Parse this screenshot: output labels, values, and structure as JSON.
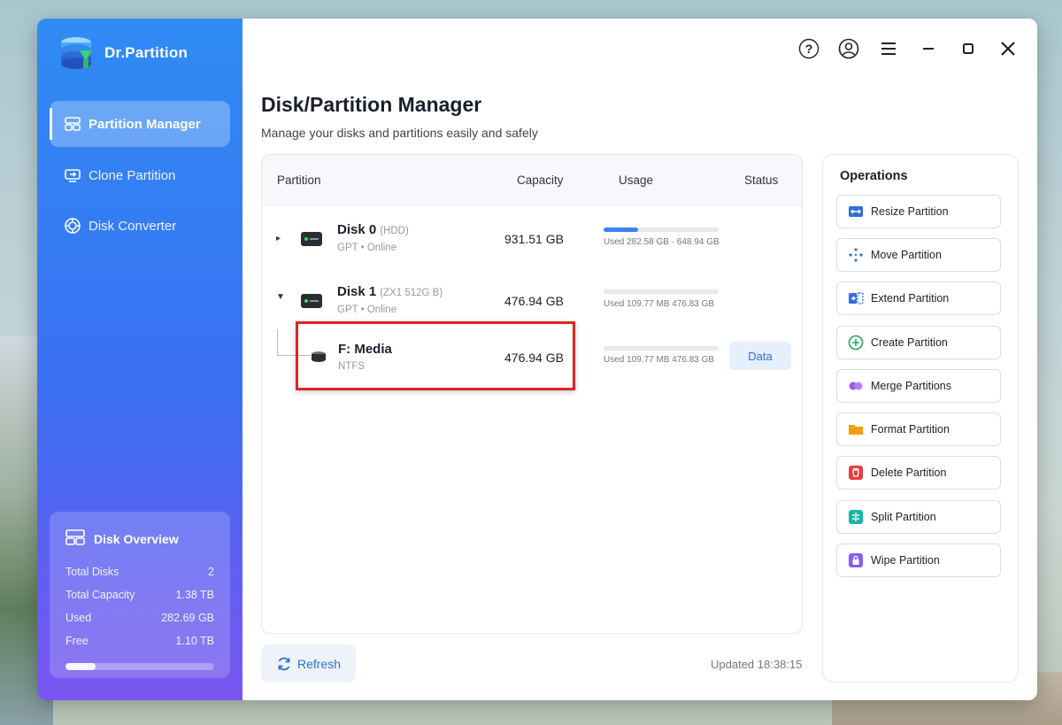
{
  "app": {
    "name": "Dr.Partition"
  },
  "sidebar": {
    "items": [
      {
        "label": "Partition Manager",
        "active": true,
        "icon": "partition-icon"
      },
      {
        "label": "Clone Partition",
        "active": false,
        "icon": "clone-icon"
      },
      {
        "label": "Disk Converter",
        "active": false,
        "icon": "converter-icon"
      }
    ],
    "overview": {
      "title": "Disk Overview",
      "rows": [
        {
          "label": "Total Disks",
          "value": "2"
        },
        {
          "label": "Total Capacity",
          "value": "1.38 TB"
        },
        {
          "label": "Used",
          "value": "282.69 GB"
        },
        {
          "label": "Free",
          "value": "1.10 TB"
        }
      ],
      "used_fraction": 0.2
    }
  },
  "titlebar": {
    "help": "?",
    "account": "account-icon",
    "menu": "menu-icon",
    "minimize": "minimize-icon",
    "maximize": "maximize-icon",
    "close": "close-icon"
  },
  "main": {
    "title": "Disk/Partition Manager",
    "subtitle": "Manage your disks and partitions easily and safely",
    "columns": {
      "partition": "Partition",
      "capacity": "Capacity",
      "usage": "Usage",
      "status": "Status"
    },
    "disks": [
      {
        "name": "Disk 0",
        "model": "(HDD)",
        "meta": "GPT  •  Online",
        "capacity": "931.51 GB",
        "usage_used": "Used 282.58 GB",
        "usage_total": "648.94 GB",
        "usage_fraction": 0.3,
        "expanded": false
      },
      {
        "name": "Disk 1",
        "model": "(ZX1 512G B)",
        "meta": "GPT  •  Online",
        "capacity": "476.94 GB",
        "usage_used": "Used 109.77 MB",
        "usage_total": "476.83 GB",
        "usage_fraction": 0.0,
        "expanded": true
      }
    ],
    "partition": {
      "name": "F: Media",
      "fs": "NTFS",
      "capacity": "476.94 GB",
      "usage_used": "Used 109.77 MB",
      "usage_total": "476.83 GB",
      "usage_fraction": 0.0,
      "status": "Data"
    },
    "refresh": "Refresh",
    "updated": "Updated 18:38:15"
  },
  "operations": {
    "title": "Operations",
    "items": [
      {
        "label": "Resize Partition",
        "icon": "resize-icon",
        "color": "#2f6fd9"
      },
      {
        "label": "Move Partition",
        "icon": "move-icon",
        "color": "#2f6fd9"
      },
      {
        "label": "Extend Partition",
        "icon": "extend-icon",
        "color": "#2f6fd9"
      },
      {
        "label": "Create Partition",
        "icon": "create-icon",
        "color": "#22a55b"
      },
      {
        "label": "Merge Partitions",
        "icon": "merge-icon",
        "color": "#9b5de5"
      },
      {
        "label": "Format Partition",
        "icon": "format-icon",
        "color": "#f59e0b"
      },
      {
        "label": "Delete Partition",
        "icon": "delete-icon",
        "color": "#e53e3e"
      },
      {
        "label": "Split Partition",
        "icon": "split-icon",
        "color": "#14b8a6"
      },
      {
        "label": "Wipe Partition",
        "icon": "wipe-icon",
        "color": "#8b5cf6"
      }
    ]
  }
}
